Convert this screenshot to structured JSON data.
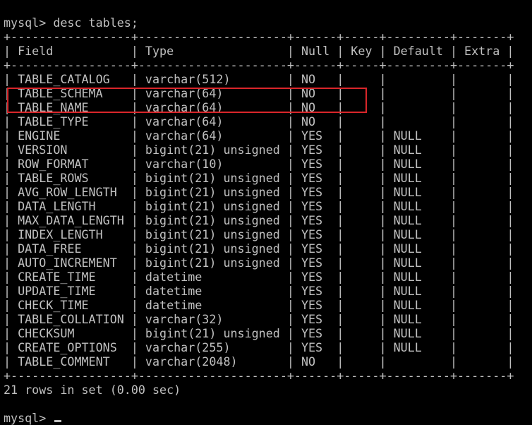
{
  "console": {
    "command_prompt": "mysql> desc tables;",
    "border": "+-----------------+---------------------+------+-----+---------+-------+",
    "header": "| Field           | Type                | Null | Key | Default | Extra |",
    "rows": [
      "| TABLE_CATALOG   | varchar(512)        | NO   |     |         |       |",
      "| TABLE_SCHEMA    | varchar(64)         | NO   |     |         |       |",
      "| TABLE_NAME      | varchar(64)         | NO   |     |         |       |",
      "| TABLE_TYPE      | varchar(64)         | NO   |     |         |       |",
      "| ENGINE          | varchar(64)         | YES  |     | NULL    |       |",
      "| VERSION         | bigint(21) unsigned | YES  |     | NULL    |       |",
      "| ROW_FORMAT      | varchar(10)         | YES  |     | NULL    |       |",
      "| TABLE_ROWS      | bigint(21) unsigned | YES  |     | NULL    |       |",
      "| AVG_ROW_LENGTH  | bigint(21) unsigned | YES  |     | NULL    |       |",
      "| DATA_LENGTH     | bigint(21) unsigned | YES  |     | NULL    |       |",
      "| MAX_DATA_LENGTH | bigint(21) unsigned | YES  |     | NULL    |       |",
      "| INDEX_LENGTH    | bigint(21) unsigned | YES  |     | NULL    |       |",
      "| DATA_FREE       | bigint(21) unsigned | YES  |     | NULL    |       |",
      "| AUTO_INCREMENT  | bigint(21) unsigned | YES  |     | NULL    |       |",
      "| CREATE_TIME     | datetime            | YES  |     | NULL    |       |",
      "| UPDATE_TIME     | datetime            | YES  |     | NULL    |       |",
      "| CHECK_TIME      | datetime            | YES  |     | NULL    |       |",
      "| TABLE_COLLATION | varchar(32)         | YES  |     | NULL    |       |",
      "| CHECKSUM        | bigint(21) unsigned | YES  |     | NULL    |       |",
      "| CREATE_OPTIONS  | varchar(255)        | YES  |     | NULL    |       |",
      "| TABLE_COMMENT   | varchar(2048)       | NO   |     |         |       |"
    ],
    "summary": "21 rows in set (0.00 sec)",
    "final_prompt": "mysql> "
  },
  "colors": {
    "background": "#000000",
    "text": "#c0c0c0",
    "highlight": "#d9262a"
  }
}
